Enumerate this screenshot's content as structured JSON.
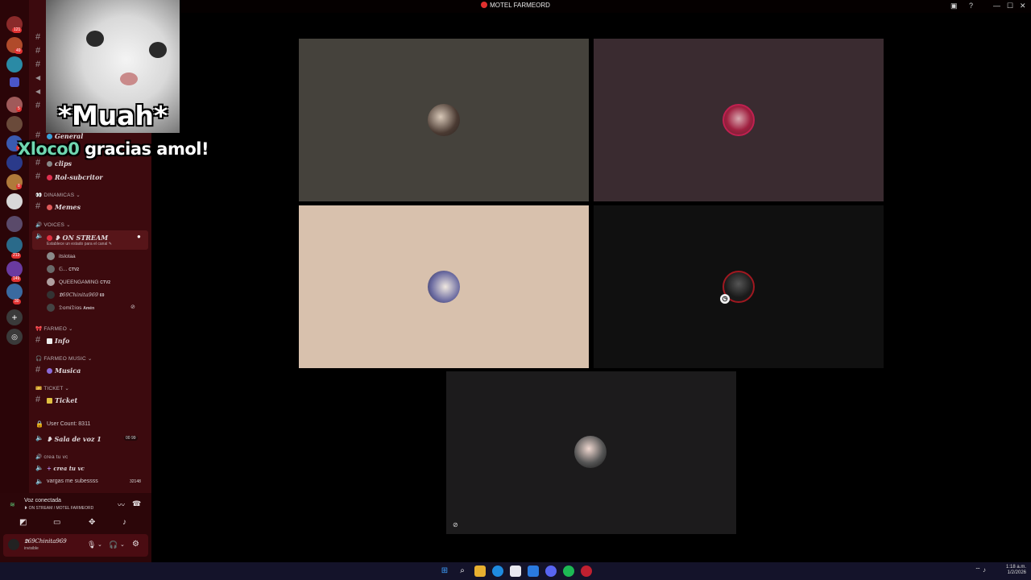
{
  "window": {
    "title": "MOTEL FARMEORD",
    "ctl_help": "?",
    "ctl_min": "—",
    "ctl_max": "☐",
    "ctl_close": "✕"
  },
  "rail": {
    "badges": [
      "121",
      "49",
      "5",
      "1",
      "8",
      "213",
      "149",
      "30"
    ]
  },
  "overlay": {
    "caption": "*Muah*",
    "username": "Xloco0",
    "message": " gracias amol!"
  },
  "channels": {
    "general": "General",
    "clips": "clips",
    "rol": "Rol-subcritor",
    "cat_dinamicas": "DINAMICAS",
    "memes": "Memes",
    "cat_voices": "VOICES",
    "on_stream": "❥ ON STREAM",
    "on_stream_status": "Establece un estado para el canal",
    "members": [
      {
        "name": "itslotaa",
        "tag": ""
      },
      {
        "name": "𝔾...",
        "tag": "CTV2"
      },
      {
        "name": "QUEENGAMING",
        "tag": "CTV2"
      },
      {
        "name": "𝕯69Chinita969",
        "tag": "69"
      },
      {
        "name": "𝔇omi𝔇ios",
        "tag": "Amén"
      }
    ],
    "cat_farmeo": "FARMEO",
    "info": "Info",
    "cat_farmeo_music": "FARMEO MUSIC",
    "musica": "Musica",
    "cat_ticket": "TICKET",
    "ticket": "Ticket",
    "user_count": "User Count: 8311",
    "sala": "❥ Sala de voz 1",
    "sala_counts": "00   99",
    "crea_cat": "crea tu vc",
    "crea": "crea tu vc",
    "vargas": "vargas me subessss",
    "vargas_count": "32148"
  },
  "voice": {
    "status": "Voz conectada",
    "channel": "❥ ON STREAM / MOTEL FARMEORD"
  },
  "user": {
    "name": "𝕯69Chinita969",
    "status": "invisible"
  },
  "tray": {
    "time": "1:18 a.m.",
    "date": "1/2/2026"
  },
  "colors": {
    "rail": "#2b0508",
    "channels": "#3c0a0e",
    "tile1": "#45423c",
    "tile2": "#3a2b30",
    "tile3": "#d8c1ad",
    "tile4": "#101010",
    "tile5": "#1c1b1c",
    "username_overlay": "#6fd6b0"
  },
  "icons": [
    "mic-icon",
    "headphones-icon",
    "settings-icon",
    "disconnect-icon",
    "camera-icon",
    "screenshare-icon",
    "activity-icon",
    "soundboard-icon",
    "windows-start-icon",
    "search-icon"
  ]
}
